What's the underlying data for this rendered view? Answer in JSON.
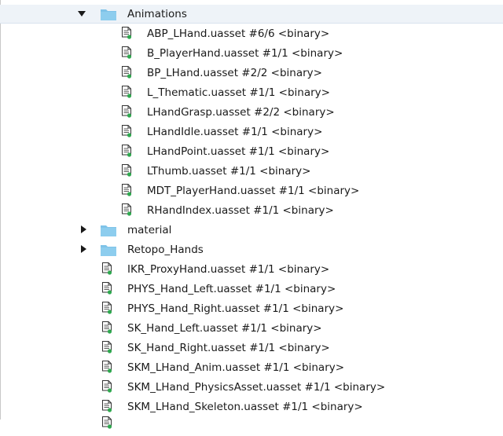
{
  "tree": {
    "animations_folder": {
      "label": "Animations",
      "expanded": true
    },
    "animation_files": [
      {
        "label": "ABP_LHand.uasset #6/6 <binary>"
      },
      {
        "label": "B_PlayerHand.uasset #1/1 <binary>"
      },
      {
        "label": "BP_LHand.uasset #2/2 <binary>"
      },
      {
        "label": "L_Thematic.uasset #1/1 <binary>"
      },
      {
        "label": "LHandGrasp.uasset #2/2 <binary>"
      },
      {
        "label": "LHandIdle.uasset #1/1 <binary>"
      },
      {
        "label": "LHandPoint.uasset #1/1 <binary>"
      },
      {
        "label": "LThumb.uasset #1/1 <binary>"
      },
      {
        "label": "MDT_PlayerHand.uasset #1/1 <binary>"
      },
      {
        "label": "RHandIndex.uasset #1/1 <binary>"
      }
    ],
    "collapsed_folders": [
      {
        "label": "material",
        "expanded": false
      },
      {
        "label": "Retopo_Hands",
        "expanded": false
      }
    ],
    "root_files": [
      {
        "label": "IKR_ProxyHand.uasset #1/1 <binary>"
      },
      {
        "label": "PHYS_Hand_Left.uasset #1/1 <binary>"
      },
      {
        "label": "PHYS_Hand_Right.uasset #1/1 <binary>"
      },
      {
        "label": "SK_Hand_Left.uasset #1/1 <binary>"
      },
      {
        "label": "SK_Hand_Right.uasset #1/1 <binary>"
      },
      {
        "label": "SKM_LHand_Anim.uasset #1/1 <binary>"
      },
      {
        "label": "SKM_LHand_PhysicsAsset.uasset #1/1 <binary>"
      },
      {
        "label": "SKM_LHand_Skeleton.uasset #1/1 <binary>"
      }
    ]
  },
  "colors": {
    "folder": "#7fc3e8",
    "folder_dark": "#5aa9d6",
    "status_added": "#2fa84f",
    "selection": "#eef3f8"
  },
  "icons": {
    "expanded": "triangle-down-icon",
    "collapsed": "triangle-right-icon",
    "folder": "folder-icon",
    "file": "file-added-icon"
  }
}
